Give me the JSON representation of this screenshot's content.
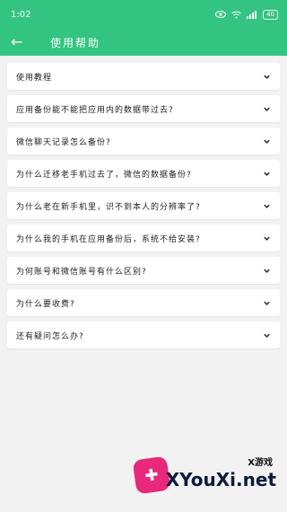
{
  "statusbar": {
    "time": "1:02",
    "battery": "40"
  },
  "appbar": {
    "title": "使用帮助"
  },
  "faq_items": [
    "使用教程",
    "应用备份能不能把应用内的数据带过去?",
    "微信聊天记录怎么备份?",
    "为什么迁移老手机过去了，微信的数据备份?",
    "为什么老在新手机里，识不到本人的分辨率了?",
    "为什么我的手机在应用备份后，系统不给安装?",
    "为何账号和微信账号有什么区别?",
    "为什么要收费?",
    "还有疑问怎么办?"
  ],
  "watermark": {
    "small": "X游戏",
    "big": "XYouXi.net"
  },
  "colors": {
    "accent": "#33c481"
  }
}
